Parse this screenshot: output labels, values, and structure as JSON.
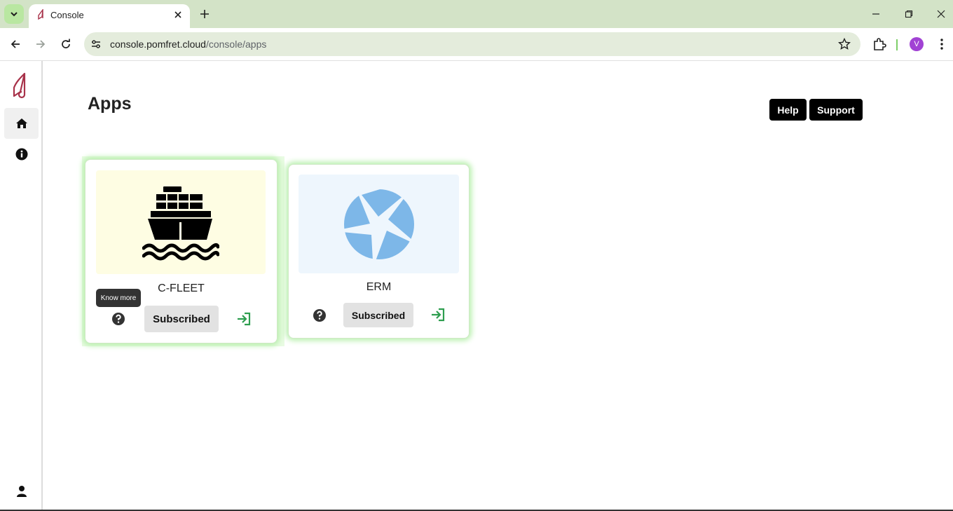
{
  "browser": {
    "tab_title": "Console",
    "url_host": "console.pomfret.cloud",
    "url_path": "/console/apps",
    "profile_initial": "V"
  },
  "page": {
    "title": "Apps",
    "help_label": "Help",
    "support_label": "Support"
  },
  "apps": [
    {
      "name": "C-FLEET",
      "status_label": "Subscribed",
      "image_bg": "#fefde3",
      "icon": "ship-icon",
      "tooltip": "Know more"
    },
    {
      "name": "ERM",
      "status_label": "Subscribed",
      "image_bg": "#eef6fd",
      "icon": "aperture-icon"
    }
  ],
  "colors": {
    "accent_green": "#2e9e4f",
    "card_glow": "#b8f0ad",
    "aperture_blue": "#7db7e8",
    "logo_red": "#a8324a"
  }
}
